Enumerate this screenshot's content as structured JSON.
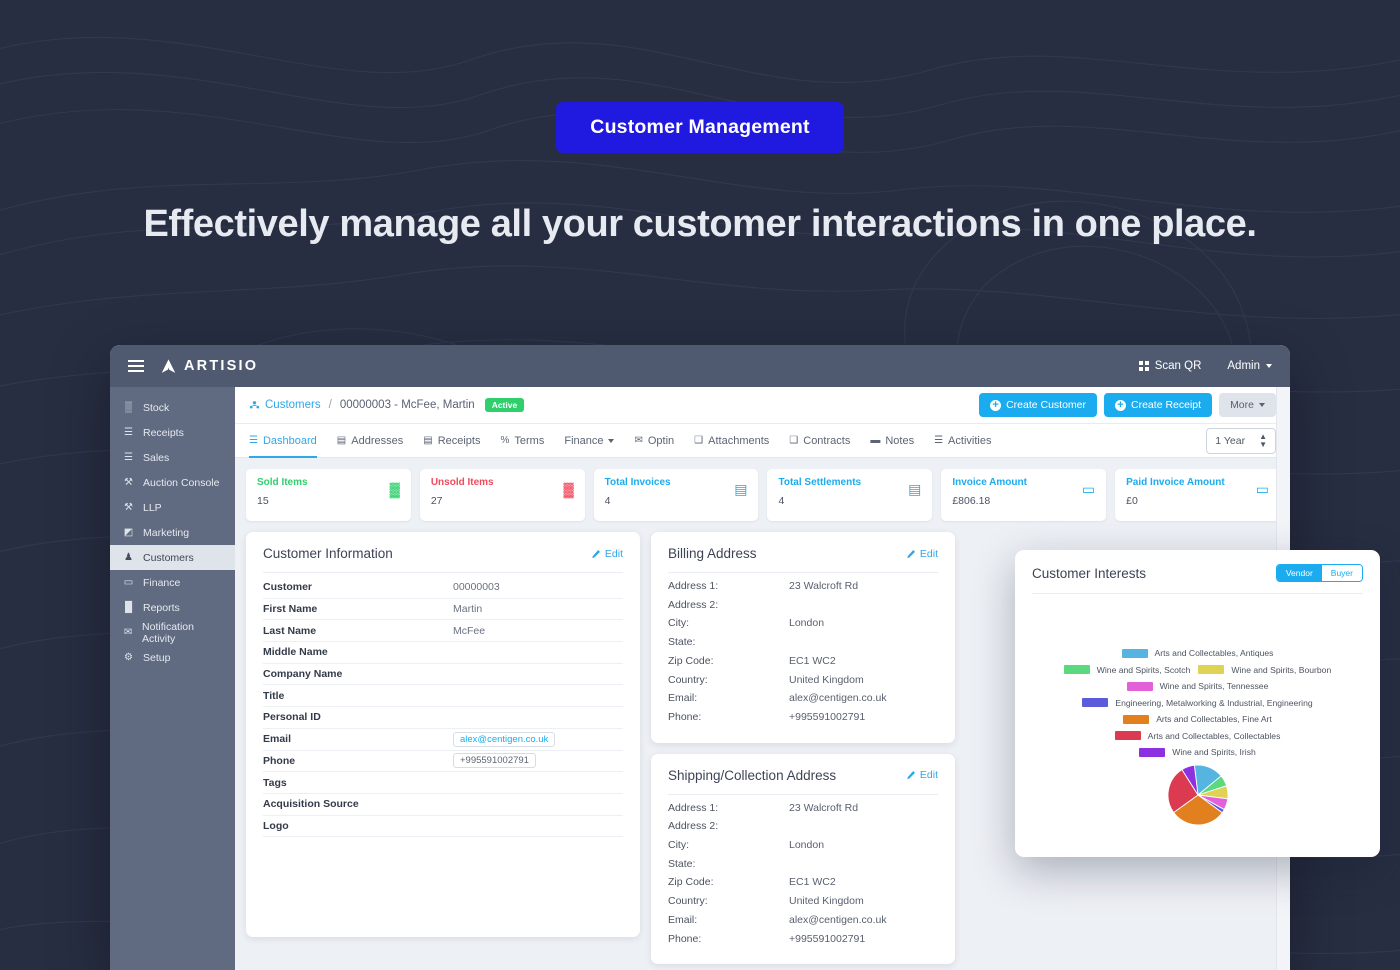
{
  "hero": {
    "badge": "Customer Management",
    "title": "Effectively manage all your customer interactions in one place."
  },
  "colors": {
    "page_bg": "#272e42",
    "badge_bg": "#2019e0",
    "accent": "#1bacef",
    "link": "#2fa8e8",
    "topbar": "#4f5a70",
    "sidebar": "#606b81",
    "success": "#2fcf6c",
    "danger": "#f04b5e"
  },
  "topbar": {
    "menu_icon": "hamburger-icon",
    "logo_icon": "artisio-logo-icon",
    "brand": "ARTISIO",
    "scan_qr": "Scan QR",
    "scan_qr_icon": "qr-code-icon",
    "admin": "Admin",
    "admin_caret_icon": "chevron-down-icon"
  },
  "sidebar": {
    "items": [
      {
        "label": "Stock",
        "icon": "boxes-icon",
        "glyph": "▒",
        "active": false
      },
      {
        "label": "Receipts",
        "icon": "receipt-icon",
        "glyph": "☰",
        "active": false
      },
      {
        "label": "Sales",
        "icon": "list-icon",
        "glyph": "☰",
        "active": false
      },
      {
        "label": "Auction Console",
        "icon": "gavel-icon",
        "glyph": "⚒",
        "active": false
      },
      {
        "label": "LLP",
        "icon": "gavel-icon",
        "glyph": "⚒",
        "active": false
      },
      {
        "label": "Marketing",
        "icon": "megaphone-icon",
        "glyph": "◩",
        "active": false
      },
      {
        "label": "Customers",
        "icon": "user-icon",
        "glyph": "♟",
        "active": true
      },
      {
        "label": "Finance",
        "icon": "wallet-icon",
        "glyph": "▭",
        "active": false
      },
      {
        "label": "Reports",
        "icon": "bar-chart-icon",
        "glyph": "█",
        "active": false
      },
      {
        "label": "Notification Activity",
        "icon": "envelope-icon",
        "glyph": "✉",
        "active": false
      },
      {
        "label": "Setup",
        "icon": "gear-icon",
        "glyph": "⚙",
        "active": false
      }
    ]
  },
  "breadcrumb": {
    "root": "Customers",
    "root_icon": "people-icon",
    "separator": "/",
    "current": "00000003 - McFee, Martin",
    "status": "Active"
  },
  "actions": {
    "create_customer": "Create Customer",
    "create_receipt": "Create Receipt",
    "more": "More",
    "more_caret_icon": "chevron-down-icon"
  },
  "tabs": [
    {
      "label": "Dashboard",
      "icon": "dashboard-icon",
      "glyph": "☰",
      "active": true,
      "caret": false
    },
    {
      "label": "Addresses",
      "icon": "address-book-icon",
      "glyph": "▤",
      "active": false,
      "caret": false
    },
    {
      "label": "Receipts",
      "icon": "receipt-icon",
      "glyph": "▤",
      "active": false,
      "caret": false
    },
    {
      "label": "Terms",
      "icon": "percent-icon",
      "glyph": "%",
      "active": false,
      "caret": false
    },
    {
      "label": "Finance",
      "icon": "none",
      "glyph": "",
      "active": false,
      "caret": true
    },
    {
      "label": "Optin",
      "icon": "envelope-icon",
      "glyph": "✉",
      "active": false,
      "caret": false
    },
    {
      "label": "Attachments",
      "icon": "files-icon",
      "glyph": "❑",
      "active": false,
      "caret": false
    },
    {
      "label": "Contracts",
      "icon": "files-icon",
      "glyph": "❑",
      "active": false,
      "caret": false
    },
    {
      "label": "Notes",
      "icon": "comment-icon",
      "glyph": "▬",
      "active": false,
      "caret": false
    },
    {
      "label": "Activities",
      "icon": "list-icon",
      "glyph": "☰",
      "active": false,
      "caret": false
    }
  ],
  "period_filter": {
    "value": "1 Year",
    "caret_icon": "updown-caret-icon"
  },
  "stats": [
    {
      "label": "Sold Items",
      "value": "15",
      "color": "#2fcf6c",
      "icon": "boxes-icon",
      "glyph": "▓"
    },
    {
      "label": "Unsold Items",
      "value": "27",
      "color": "#f04b5e",
      "icon": "boxes-icon",
      "glyph": "▓"
    },
    {
      "label": "Total Invoices",
      "value": "4",
      "color": "#1bacef",
      "icon": "invoice-icon",
      "glyph": "▤"
    },
    {
      "label": "Total Settlements",
      "value": "4",
      "color": "#1bacef",
      "icon": "invoice-icon",
      "glyph": "▤"
    },
    {
      "label": "Invoice Amount",
      "value": "£806.18",
      "color": "#1bacef",
      "icon": "banknote-icon",
      "glyph": "▭"
    },
    {
      "label": "Paid Invoice Amount",
      "value": "£0",
      "color": "#1bacef",
      "icon": "banknote-icon",
      "glyph": "▭"
    }
  ],
  "customer_information": {
    "title": "Customer Information",
    "edit": "Edit",
    "edit_icon": "pencil-icon",
    "rows": [
      {
        "key": "Customer",
        "value": "00000003",
        "style": "plain"
      },
      {
        "key": "First Name",
        "value": "Martin",
        "style": "plain"
      },
      {
        "key": "Last Name",
        "value": "McFee",
        "style": "plain"
      },
      {
        "key": "Middle Name",
        "value": "",
        "style": "plain"
      },
      {
        "key": "Company Name",
        "value": "",
        "style": "plain"
      },
      {
        "key": "Title",
        "value": "",
        "style": "plain"
      },
      {
        "key": "Personal ID",
        "value": "",
        "style": "plain"
      },
      {
        "key": "Email",
        "value": "alex@centigen.co.uk",
        "style": "pill-blue"
      },
      {
        "key": "Phone",
        "value": "+995591002791",
        "style": "pill-gray"
      },
      {
        "key": "Tags",
        "value": "",
        "style": "plain"
      },
      {
        "key": "Acquisition Source",
        "value": "",
        "style": "plain"
      },
      {
        "key": "Logo",
        "value": "",
        "style": "plain"
      }
    ]
  },
  "billing_address": {
    "title": "Billing Address",
    "edit": "Edit",
    "edit_icon": "pencil-icon",
    "rows": [
      {
        "key": "Address 1:",
        "value": "23 Walcroft Rd"
      },
      {
        "key": "Address 2:",
        "value": ""
      },
      {
        "key": "City:",
        "value": "London"
      },
      {
        "key": "State:",
        "value": ""
      },
      {
        "key": "Zip Code:",
        "value": "EC1 WC2"
      },
      {
        "key": "Country:",
        "value": "United Kingdom"
      },
      {
        "key": "Email:",
        "value": "alex@centigen.co.uk"
      },
      {
        "key": "Phone:",
        "value": "+995591002791"
      }
    ]
  },
  "shipping_address": {
    "title": "Shipping/Collection Address",
    "edit": "Edit",
    "edit_icon": "pencil-icon",
    "rows": [
      {
        "key": "Address 1:",
        "value": "23 Walcroft Rd"
      },
      {
        "key": "Address 2:",
        "value": ""
      },
      {
        "key": "City:",
        "value": "London"
      },
      {
        "key": "State:",
        "value": ""
      },
      {
        "key": "Zip Code:",
        "value": "EC1 WC2"
      },
      {
        "key": "Country:",
        "value": "United Kingdom"
      },
      {
        "key": "Email:",
        "value": "alex@centigen.co.uk"
      },
      {
        "key": "Phone:",
        "value": "+995591002791"
      }
    ]
  },
  "customer_interests": {
    "title": "Customer Interests",
    "toggle": {
      "vendor": "Vendor",
      "buyer": "Buyer",
      "selected": "Vendor"
    }
  },
  "chart_data": {
    "type": "pie",
    "title": "Customer Interests",
    "legend_position": "top",
    "labels": [
      "Arts and Collectables, Antiques",
      "Wine and Spirits, Scotch",
      "Wine and Spirits, Bourbon",
      "Wine and Spirits, Tennessee",
      "Engineering, Metalworking & Industrial, Engineering",
      "Arts and Collectables, Fine Art",
      "Arts and Collectables, Collectables",
      "Wine and Spirits, Irish"
    ],
    "colors": [
      "#56b4e0",
      "#5ad97e",
      "#dfd255",
      "#e361d8",
      "#5b5bdb",
      "#e2801f",
      "#dc3a51",
      "#8c30e0"
    ],
    "values": [
      16,
      6,
      7,
      6,
      2,
      30,
      26,
      7
    ],
    "legend_rows": [
      [
        0
      ],
      [
        1,
        2
      ],
      [
        3
      ],
      [
        4
      ],
      [
        5
      ],
      [
        6
      ],
      [
        7
      ]
    ]
  }
}
